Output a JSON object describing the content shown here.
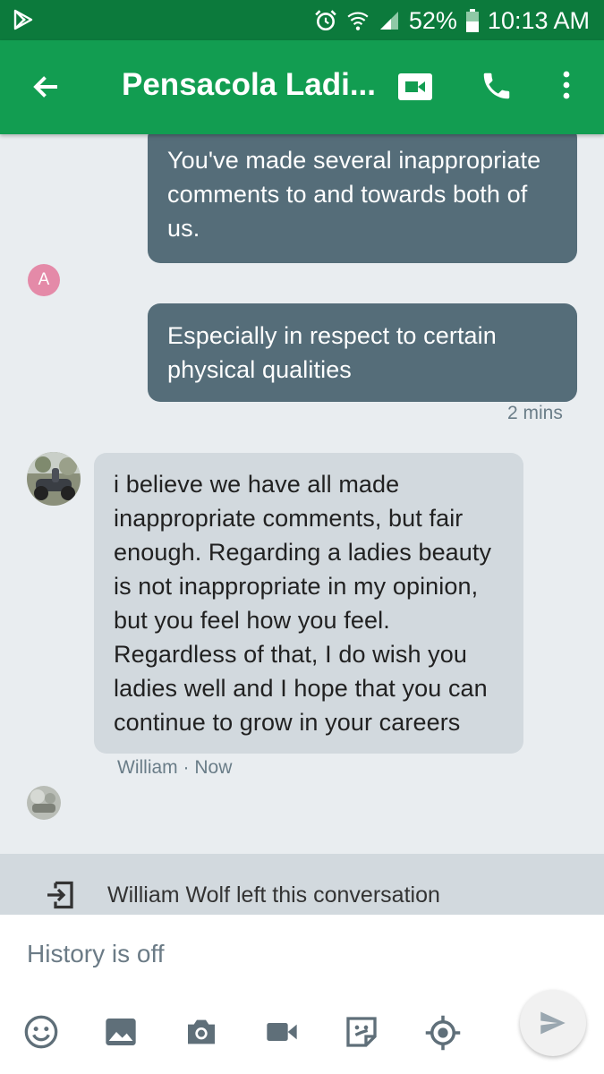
{
  "status_bar": {
    "battery": "52%",
    "time": "10:13 AM"
  },
  "app_bar": {
    "title": "Pensacola Ladi..."
  },
  "messages": [
    {
      "type": "outgoing",
      "text": "You've made several inappropriate comments to and towards both of us."
    },
    {
      "type": "outgoing",
      "text": "Especially in respect to certain physical qualities",
      "time": "2 mins"
    },
    {
      "type": "incoming",
      "text": "i believe we have all made inappropriate comments, but fair enough.  Regarding a ladies beauty is not inappropriate in my opinion, but you feel how you feel. Regardless of that, I do wish you ladies well and I hope that you can continue to grow in your careers",
      "sender": "William",
      "separator": "·",
      "time": "Now"
    }
  ],
  "avatars": {
    "a_initial": "A"
  },
  "system_message": "William Wolf left this conversation",
  "composer": {
    "history_text": "History is off"
  },
  "toolbar_icons": [
    "emoji-icon",
    "image-icon",
    "camera-icon",
    "video-icon",
    "sticker-icon",
    "location-icon",
    "send-icon"
  ],
  "colors": {
    "status_bar": "#0c7a3c",
    "app_bar": "#129d51",
    "outgoing_bubble": "#556d79",
    "incoming_bubble": "#d2d9de",
    "background": "#e9edf0"
  }
}
